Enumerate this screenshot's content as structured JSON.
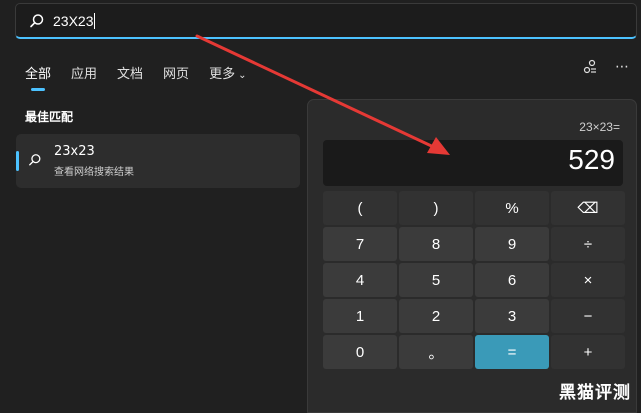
{
  "search": {
    "query": "23X23"
  },
  "tabs": [
    {
      "label": "全部"
    },
    {
      "label": "应用"
    },
    {
      "label": "文档"
    },
    {
      "label": "网页"
    },
    {
      "label": "更多"
    }
  ],
  "section": {
    "best_match_title": "最佳匹配"
  },
  "best_match": {
    "title": "23x23",
    "subtitle": "查看网络搜索结果"
  },
  "calculator": {
    "expression": "23×23=",
    "result": "529",
    "keys": [
      "(",
      ")",
      "%",
      "⌫",
      "7",
      "8",
      "9",
      "÷",
      "4",
      "5",
      "6",
      "×",
      "1",
      "2",
      "3",
      "−",
      "0",
      "。",
      "=",
      "+"
    ]
  },
  "watermark": "黑猫评测",
  "colors": {
    "accent": "#4cc2ff",
    "equals": "#3a9ab8",
    "arrow": "#e53935"
  }
}
